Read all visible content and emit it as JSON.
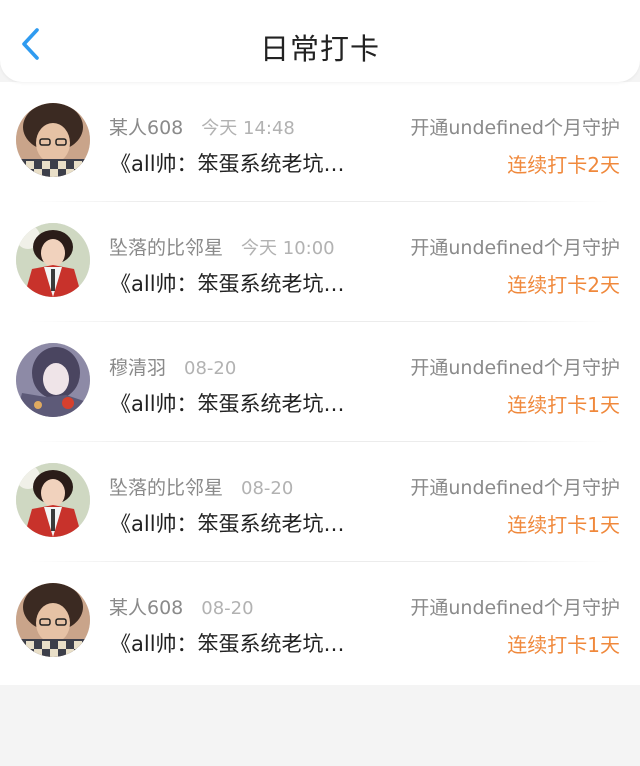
{
  "header": {
    "title": "日常打卡",
    "back_icon": "chevron-left-icon",
    "accent": "#2f9bf0"
  },
  "items": [
    {
      "name": "某人608",
      "time": "今天 14:48",
      "guard": "开通undefined个月守护",
      "book": "《all帅：笨蛋系统老坑…",
      "streak": "连续打卡2天",
      "avatar": "avatar-a"
    },
    {
      "name": "坠落的比邻星",
      "time": "今天 10:00",
      "guard": "开通undefined个月守护",
      "book": "《all帅：笨蛋系统老坑…",
      "streak": "连续打卡2天",
      "avatar": "avatar-b"
    },
    {
      "name": "穆清羽",
      "time": "08-20",
      "guard": "开通undefined个月守护",
      "book": "《all帅：笨蛋系统老坑…",
      "streak": "连续打卡1天",
      "avatar": "avatar-c"
    },
    {
      "name": "坠落的比邻星",
      "time": "08-20",
      "guard": "开通undefined个月守护",
      "book": "《all帅：笨蛋系统老坑…",
      "streak": "连续打卡1天",
      "avatar": "avatar-b"
    },
    {
      "name": "某人608",
      "time": "08-20",
      "guard": "开通undefined个月守护",
      "book": "《all帅：笨蛋系统老坑…",
      "streak": "连续打卡1天",
      "avatar": "avatar-a"
    }
  ],
  "colors": {
    "streak": "#f0893c",
    "name": "#8a8a8a",
    "time": "#b2b2b2",
    "text": "#222222"
  }
}
